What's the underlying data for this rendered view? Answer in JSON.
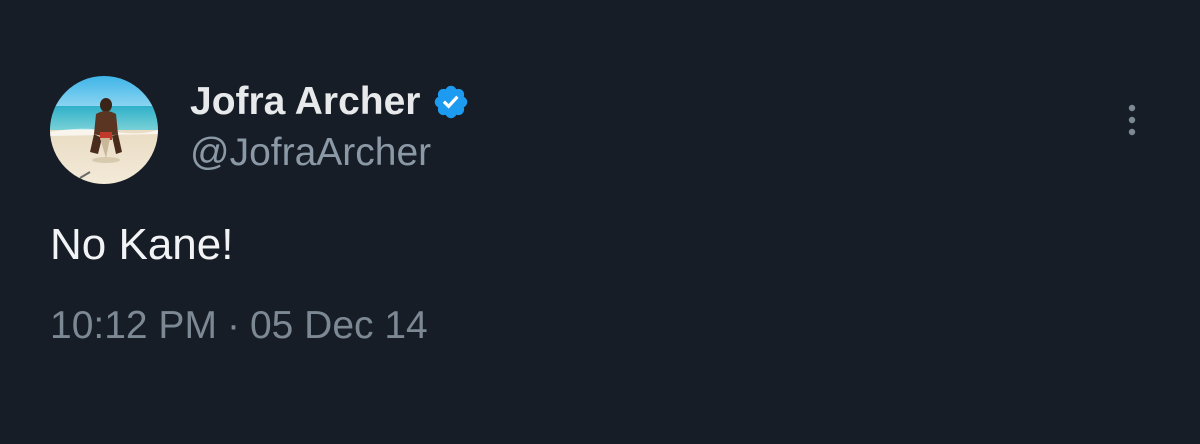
{
  "tweet": {
    "author": {
      "display_name": "Jofra Archer",
      "handle": "@JofraArcher",
      "verified": true,
      "verified_icon": "verified-badge-icon",
      "avatar_icon": "avatar-photo"
    },
    "text": "No Kane!",
    "time": "10:12 PM",
    "separator": "·",
    "date": "05 Dec 14",
    "more_icon": "more-vertical-icon"
  },
  "colors": {
    "background": "#161d27",
    "name": "#e7e9ea",
    "secondary_text": "#8b98a5",
    "verified_blue": "#1d9bf0"
  }
}
